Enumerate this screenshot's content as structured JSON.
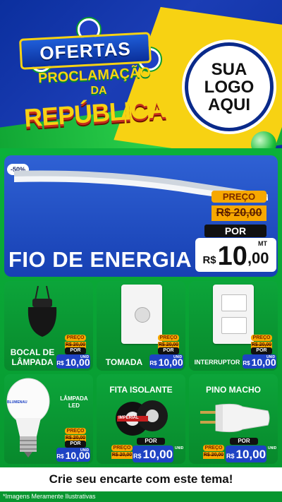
{
  "header": {
    "title_line1": "OFERTAS",
    "title_line2": "PROCLAMAÇÃO",
    "title_line3": "DA",
    "title_line4": "REPÚBLICA",
    "logo_line1": "SUA",
    "logo_line2": "LOGO",
    "logo_line3": "AQUI"
  },
  "featured": {
    "discount_badge": "-50%",
    "name": "FIO DE ENERGIA",
    "preco_label": "PREÇO",
    "old_price": "R$ 20,00",
    "por_label": "POR",
    "currency": "R$",
    "price_int": "10",
    "price_dec": ",00",
    "unit": "MT"
  },
  "products": [
    {
      "name_line1": "BOCAL DE",
      "name_line2": "LÂMPADA",
      "preco_label": "PREÇO",
      "old_price": "R$ 20,00",
      "por_label": "POR",
      "currency": "R$",
      "price": "10,00",
      "unit": "UNID"
    },
    {
      "name": "TOMADA",
      "preco_label": "PREÇO",
      "old_price": "R$ 20,00",
      "por_label": "POR",
      "currency": "R$",
      "price": "10,00",
      "unit": "UNID"
    },
    {
      "name": "INTERRUPTOR",
      "preco_label": "PREÇO",
      "old_price": "R$ 20,00",
      "por_label": "POR",
      "currency": "R$",
      "price": "10,00",
      "unit": "UNID"
    },
    {
      "name_line1": "LÂMPADA",
      "name_line2": "LED",
      "preco_label": "PREÇO",
      "old_price": "R$ 20,00",
      "por_label": "POR",
      "currency": "R$",
      "price": "10,00",
      "unit": "UNID",
      "brand": "BLUMENAU"
    },
    {
      "name": "FITA ISOLANTE",
      "preco_label": "PREÇO",
      "old_price": "R$ 20,00",
      "por_label": "POR",
      "currency": "R$",
      "price": "10,00",
      "unit": "UNID",
      "brand": "IMPERIAL"
    },
    {
      "name": "PINO MACHO",
      "preco_label": "PREÇO",
      "old_price": "R$ 20,00",
      "por_label": "POR",
      "currency": "R$",
      "price": "10,00",
      "unit": "UNID"
    }
  ],
  "cta": "Crie seu encarte com este tema!",
  "footnote": "*Imagens Meramente Ilustrativas",
  "colors": {
    "blue": "#0a2a8a",
    "green": "#0bb03a",
    "yellow": "#f7d213",
    "orange": "#f7a800",
    "price_blue": "#1e43c4"
  }
}
